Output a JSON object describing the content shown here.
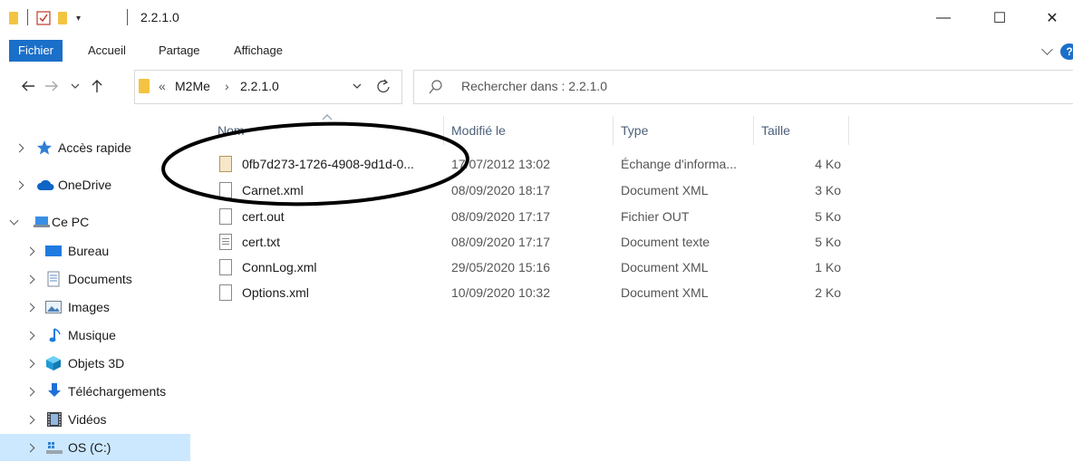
{
  "window": {
    "title": "2.2.1.0",
    "controls": {
      "minimize": "—",
      "maximize": "☐",
      "close": "✕"
    }
  },
  "ribbon": {
    "tabs": [
      "Fichier",
      "Accueil",
      "Partage",
      "Affichage"
    ],
    "help": "?"
  },
  "address": {
    "overflow": "«",
    "crumbs": [
      "M2Me",
      "2.2.1.0"
    ],
    "separator": "›"
  },
  "search": {
    "placeholder": "Rechercher dans : 2.2.1.0"
  },
  "nav": {
    "items": [
      {
        "label": "Accès rapide",
        "icon": "star-icon"
      },
      {
        "label": "OneDrive",
        "icon": "cloud-icon"
      },
      {
        "label": "Ce PC",
        "icon": "computer-icon"
      },
      {
        "label": "Bureau",
        "icon": "desktop-icon"
      },
      {
        "label": "Documents",
        "icon": "documents-icon"
      },
      {
        "label": "Images",
        "icon": "images-icon"
      },
      {
        "label": "Musique",
        "icon": "music-icon"
      },
      {
        "label": "Objets 3D",
        "icon": "3d-objects-icon"
      },
      {
        "label": "Téléchargements",
        "icon": "download-icon"
      },
      {
        "label": "Vidéos",
        "icon": "videos-icon"
      },
      {
        "label": "OS (C:)",
        "icon": "drive-icon"
      }
    ]
  },
  "columns": {
    "name": "Nom",
    "modified": "Modifié le",
    "type": "Type",
    "size": "Taille"
  },
  "files": [
    {
      "name": "0fb7d273-1726-4908-9d1d-0...",
      "modified": "17/07/2012 13:02",
      "type": "Échange d'informa...",
      "size": "4 Ko",
      "icon": "exchange-file-icon"
    },
    {
      "name": "Carnet.xml",
      "modified": "08/09/2020 18:17",
      "type": "Document XML",
      "size": "3 Ko",
      "icon": "file-icon"
    },
    {
      "name": "cert.out",
      "modified": "08/09/2020 17:17",
      "type": "Fichier OUT",
      "size": "5 Ko",
      "icon": "file-icon"
    },
    {
      "name": "cert.txt",
      "modified": "08/09/2020 17:17",
      "type": "Document texte",
      "size": "5 Ko",
      "icon": "text-file-icon"
    },
    {
      "name": "ConnLog.xml",
      "modified": "29/05/2020 15:16",
      "type": "Document XML",
      "size": "1 Ko",
      "icon": "file-icon"
    },
    {
      "name": "Options.xml",
      "modified": "10/09/2020 10:32",
      "type": "Document XML",
      "size": "2 Ko",
      "icon": "file-icon"
    }
  ]
}
